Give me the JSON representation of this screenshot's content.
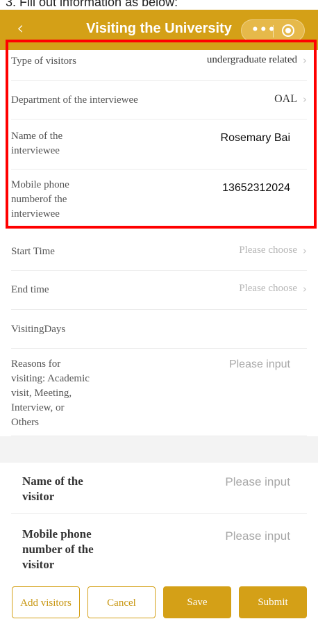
{
  "caption": "3. Fill out information as below:",
  "nav": {
    "back_icon": "‹",
    "title": "Visiting the University"
  },
  "fields": {
    "type_of_visitors": {
      "label": "Type of visitors",
      "value": "undergraduate related"
    },
    "department": {
      "label": "Department of the interviewee",
      "value": "OAL"
    },
    "interviewee_name": {
      "label_1": "Name of the",
      "label_2": "interviewee",
      "value": "Rosemary Bai"
    },
    "interviewee_phone": {
      "label_1": "Mobile phone",
      "label_2": "numberof the",
      "label_3": "interviewee",
      "value": "13652312024"
    },
    "start_time": {
      "label": "Start Time",
      "placeholder": "Please choose"
    },
    "end_time": {
      "label": "End time",
      "placeholder": "Please choose"
    },
    "visiting_days": {
      "label": "VisitingDays"
    },
    "reasons": {
      "label_1": "Reasons for",
      "label_2": "visiting: Academic",
      "label_3": "visit, Meeting,",
      "label_4": "Interview, or",
      "label_5": "Others",
      "placeholder": "Please input"
    },
    "visitor_name": {
      "label_1": "Name of the",
      "label_2": "visitor",
      "placeholder": "Please input"
    },
    "visitor_phone": {
      "label_1": "Mobile phone",
      "label_2": "number of the",
      "label_3": "visitor",
      "placeholder": "Please input"
    }
  },
  "chevron": "›",
  "buttons": {
    "add_visitors": "Add visitors",
    "cancel": "Cancel",
    "save": "Save",
    "submit": "Submit"
  },
  "colors": {
    "accent": "#d4a017",
    "highlight": "#ff0000"
  }
}
